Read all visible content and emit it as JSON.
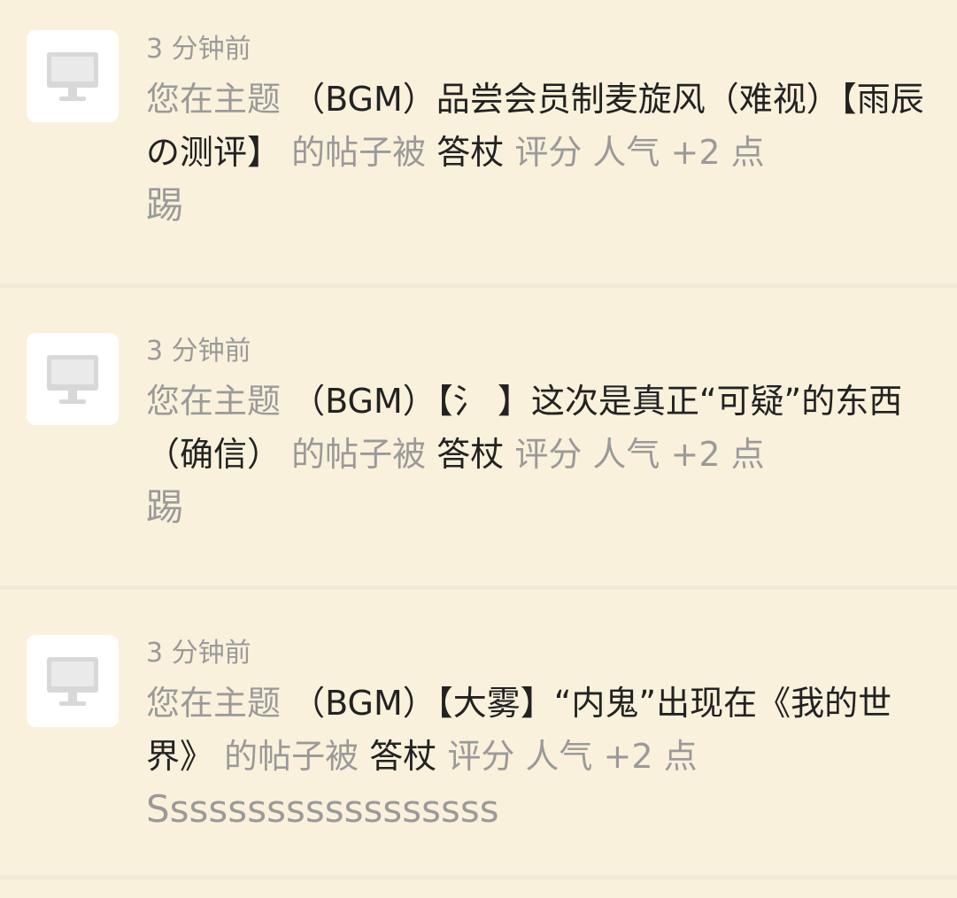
{
  "notifications": [
    {
      "time": "3 分钟前",
      "prefix": "您在主题",
      "topic": "（BGM）品尝会员制麦旋风（难视）【雨辰の测评】",
      "mid": "的帖子被",
      "user": "答杖",
      "action": "评分 人气 +2 点",
      "reason": "踢"
    },
    {
      "time": "3 分钟前",
      "prefix": "您在主题",
      "topic": "（BGM）【氵 】这次是真正“可疑”的东西（确信）",
      "mid": "的帖子被",
      "user": "答杖",
      "action": "评分 人气 +2 点",
      "reason": "踢"
    },
    {
      "time": "3 分钟前",
      "prefix": "您在主题",
      "topic": "（BGM）【大雾】“内鬼”出现在《我的世界》",
      "mid": "的帖子被",
      "user": "答杖",
      "action": "评分 人气 +2 点",
      "reason": "Ssssssssssssssssss"
    }
  ],
  "icons": {
    "avatar": "monitor-icon"
  },
  "colors": {
    "background": "#faf1dc",
    "divider": "#f1ead7",
    "text_dark": "#222222",
    "text_gray": "#9a9a9a"
  }
}
